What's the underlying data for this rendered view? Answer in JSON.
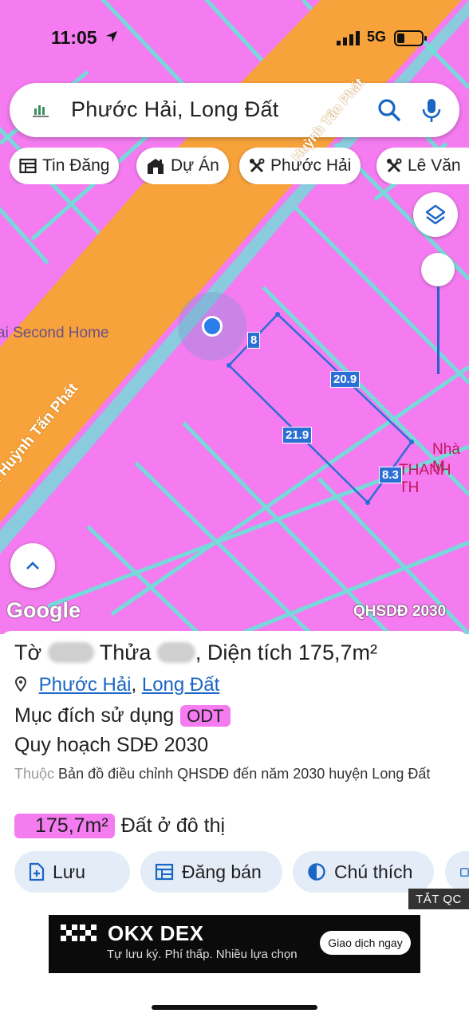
{
  "status": {
    "time": "11:05",
    "network": "5G"
  },
  "search": {
    "query": "Phước Hải, Long Đất"
  },
  "chips": [
    {
      "label": "Tin Đăng",
      "icon": "listing-icon"
    },
    {
      "label": "Dự Án",
      "icon": "building-icon"
    },
    {
      "label": "Phước Hải",
      "icon": "tools-icon"
    },
    {
      "label": "Lê Văn",
      "icon": "tools-icon"
    }
  ],
  "map": {
    "place_label": "ai Second Home",
    "street_label": "Đ. Huỳnh Tấn Phát",
    "street_label_2": "Huỳnh Tấn Phát",
    "poi_label_1": "Nhà M",
    "poi_label_2": "THANH TH",
    "dimensions": [
      "8",
      "20.9",
      "21.9",
      "8.3"
    ],
    "google_label": "Google",
    "plan_tag": "QHSDĐ 2030",
    "colors": {
      "land_residential": "#f47bf0",
      "road": "#f7a23a",
      "parcel_border": "#2b6fd6"
    }
  },
  "parcel": {
    "to_label": "Tờ",
    "thua_label": "Thửa",
    "area_text": ", Diện tích 175,7m²",
    "ward": "Phước Hải",
    "separator": ",",
    "district": "Long Đất",
    "purpose_label": "Mục đích sử dụng",
    "purpose_code": "ODT",
    "plan_title": "Quy hoạch SDĐ 2030",
    "note_prefix": "Thuộc",
    "note_text": "Bản đồ điều chỉnh QHSDĐ đến năm 2030 huyện Long Đất",
    "area_value": "175,7m²",
    "area_type": "Đất ở đô thị"
  },
  "actions": [
    {
      "label": "Lưu",
      "icon": "save-icon"
    },
    {
      "label": "Đăng bán",
      "icon": "listing-icon"
    },
    {
      "label": "Chú thích",
      "icon": "contrast-icon"
    }
  ],
  "ad": {
    "close_label": "TẮT QC",
    "title": "OKX DEX",
    "subtitle": "Tự lưu ký. Phí thấp. Nhiều lựa chọn",
    "cta": "Giao dịch ngay"
  }
}
